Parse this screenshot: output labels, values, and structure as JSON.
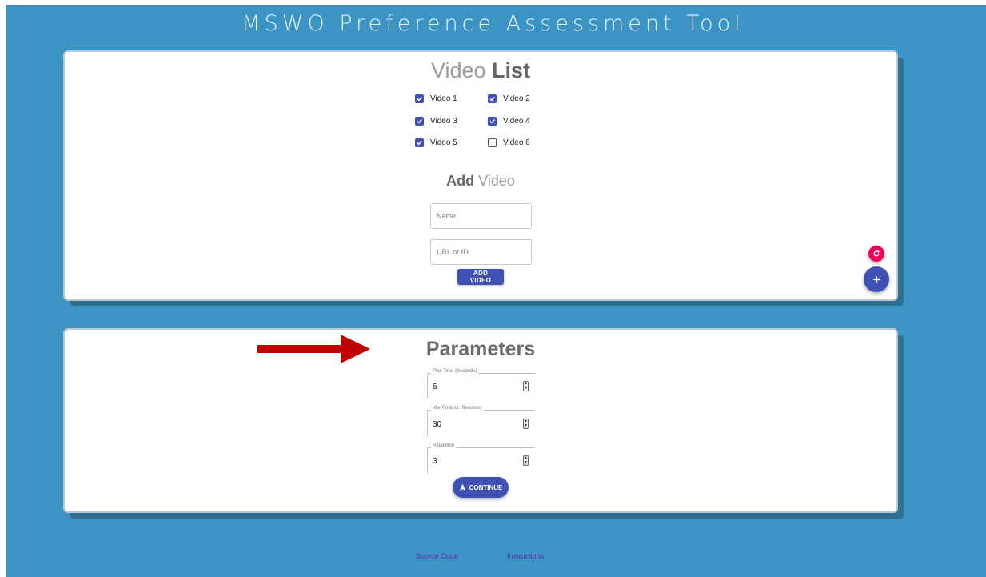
{
  "app": {
    "title": "MSWO Preference Assessment Tool"
  },
  "video_list": {
    "title_light": "Video ",
    "title_bold": "List",
    "videos": [
      {
        "label": "Video 1",
        "checked": true
      },
      {
        "label": "Video 2",
        "checked": true
      },
      {
        "label": "Video 3",
        "checked": true
      },
      {
        "label": "Video 4",
        "checked": true
      },
      {
        "label": "Video 5",
        "checked": true
      },
      {
        "label": "Video 6",
        "checked": false
      }
    ]
  },
  "add_video": {
    "title_bold": "Add",
    "title_light": " Video",
    "name_placeholder": "Name",
    "url_placeholder": "URL or ID",
    "button_label": "ADD VIDEO"
  },
  "fabs": {
    "refresh_icon": "refresh-icon",
    "add_icon": "plus-icon",
    "refresh_color": "#f50057",
    "add_color": "#3f51b5"
  },
  "parameters": {
    "title": "Parameters",
    "fields": [
      {
        "label": "Play Time (Seconds)",
        "value": "5"
      },
      {
        "label": "Idle Timeout (Seconds)",
        "value": "30"
      },
      {
        "label": "Repetition",
        "value": "3"
      }
    ],
    "continue_label": "CONTINUE",
    "continue_icon": "navigation-arrow-icon"
  },
  "annotation": {
    "arrow_color": "#c00000"
  },
  "footer": {
    "source_code": "Source Code",
    "instructions": "Instructions"
  },
  "colors": {
    "background": "#3b94c3",
    "primary": "#3f51b5",
    "secondary": "#f50057"
  }
}
